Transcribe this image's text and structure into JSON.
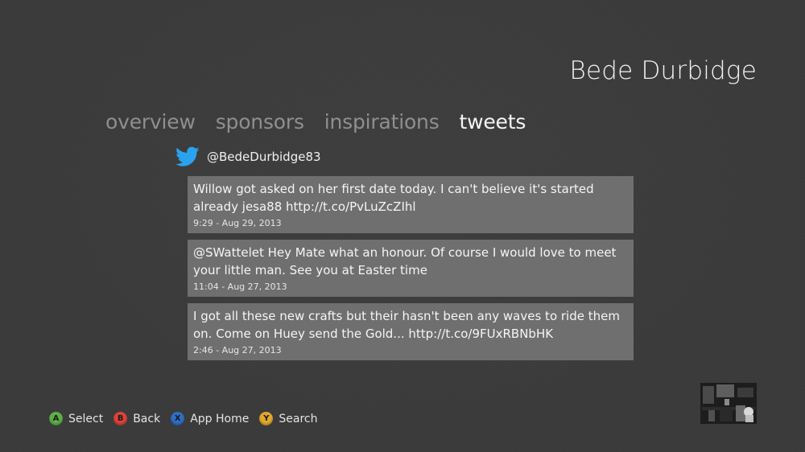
{
  "header": {
    "title": "Bede Durbidge"
  },
  "tabs": [
    {
      "label": "overview",
      "active": false
    },
    {
      "label": "sponsors",
      "active": false
    },
    {
      "label": "inspirations",
      "active": false
    },
    {
      "label": "tweets",
      "active": true
    }
  ],
  "twitter": {
    "icon": "twitter-bird-icon",
    "handle": "@BedeDurbidge83"
  },
  "tweets": [
    {
      "text": "Willow got asked on her first date today. I can't believe it's started already jesa88 http://t.co/PvLuZcZIhl",
      "time": "9:29 - Aug 29, 2013"
    },
    {
      "text": "@SWattelet Hey Mate what an honour. Of course I would love to meet your little man. See you at Easter time",
      "time": "11:04 - Aug 27, 2013"
    },
    {
      "text": "I got all these new crafts but their hasn't been any waves to ride them on. Come on Huey send the Gold... http://t.co/9FUxRBNbHK",
      "time": "2:46 - Aug 27, 2013"
    }
  ],
  "controls": [
    {
      "key": "A",
      "label": "Select",
      "color": "#5bb046"
    },
    {
      "key": "B",
      "label": "Back",
      "color": "#d9433a"
    },
    {
      "key": "X",
      "label": "App Home",
      "color": "#2f6fc4"
    },
    {
      "key": "Y",
      "label": "Search",
      "color": "#e0a92a"
    }
  ],
  "colors": {
    "background": "#3a3a3a",
    "tweet_card": "#6f6f6f",
    "tab_inactive": "#8f8f8f",
    "tab_active": "#f4f4f4",
    "twitter_blue": "#2aa3ef"
  }
}
